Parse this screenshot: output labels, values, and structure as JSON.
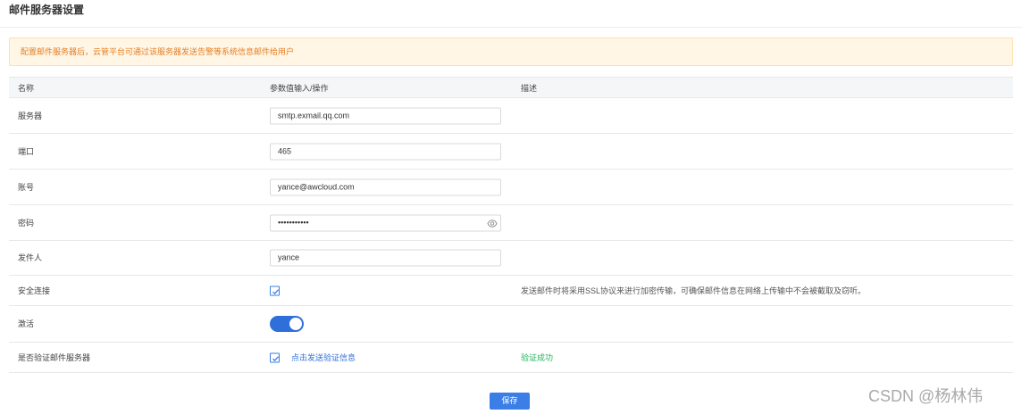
{
  "page": {
    "title": "邮件服务器设置"
  },
  "notice": {
    "text": "配置邮件服务器后，云管平台可通过该服务器发送告警等系统信息邮件给用户"
  },
  "table": {
    "headers": {
      "name": "名称",
      "param": "参数值输入/操作",
      "desc": "描述"
    },
    "rows": {
      "server": {
        "label": "服务器",
        "value": "smtp.exmail.qq.com"
      },
      "port": {
        "label": "端口",
        "value": "465"
      },
      "account": {
        "label": "账号",
        "value": "yance@awcloud.com"
      },
      "password": {
        "label": "密码",
        "value": "•••••••••••"
      },
      "sender": {
        "label": "发件人",
        "value": "yance"
      },
      "secure": {
        "label": "安全连接",
        "checked": true,
        "description": "发送邮件时将采用SSL协议来进行加密传输，可确保邮件信息在网络上传输中不会被截取及窃听。"
      },
      "activate": {
        "label": "激活",
        "enabled": true
      },
      "verify": {
        "label": "是否验证邮件服务器",
        "checked": true,
        "link": "点击发送验证信息",
        "status": "验证成功"
      }
    }
  },
  "actions": {
    "save_label": "保存"
  },
  "watermark": {
    "text": "CSDN @杨林伟"
  },
  "icons": {
    "password_visibility": "eye-icon",
    "checkbox_check": "check-icon"
  },
  "colors": {
    "accent": "#3a7ee6",
    "toggle_on": "#2e6fd9",
    "notice_bg": "#fff6e6",
    "notice_text": "#e67e22",
    "success": "#22b55a"
  }
}
